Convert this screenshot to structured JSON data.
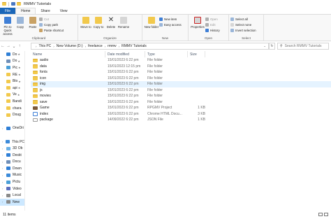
{
  "window": {
    "title": "RMMV Tutorials"
  },
  "tabs": [
    "File",
    "Home",
    "Share",
    "View"
  ],
  "ribbon": {
    "clipboard": {
      "label": "Clipboard",
      "pin": "Pin to Quick access",
      "copy": "Copy",
      "paste": "Paste",
      "cut": "Cut",
      "copy_path": "Copy path",
      "paste_shortcut": "Paste shortcut"
    },
    "organize": {
      "label": "Organize",
      "move_to": "Move to",
      "copy_to": "Copy to",
      "delete": "Delete",
      "rename": "Rename"
    },
    "new": {
      "label": "New",
      "new_folder": "New folder",
      "new_item": "New item",
      "easy_access": "Easy access"
    },
    "open": {
      "label": "Open",
      "properties": "Properties",
      "open": "Open",
      "edit": "Edit",
      "history": "History"
    },
    "select": {
      "label": "Select",
      "select_all": "Select all",
      "select_none": "Select none",
      "invert": "Invert selection"
    }
  },
  "address": {
    "crumbs": [
      "This PC",
      "New Volume (D:)",
      "freelance",
      "rmmv",
      "RMMV Tutorials"
    ],
    "search_placeholder": "Search RMMV Tutorials"
  },
  "nav": [
    {
      "label": "Do",
      "icon": "download-icon",
      "color": "#2f7fd6",
      "pin": true,
      "expand": false
    },
    {
      "label": "Do",
      "icon": "document-icon",
      "color": "#6f8fb8",
      "pin": true,
      "expand": false
    },
    {
      "label": "Pic",
      "icon": "pictures-icon",
      "color": "#4a9fd8",
      "pin": true,
      "expand": false
    },
    {
      "label": "RE",
      "icon": "folder-icon",
      "color": "#f2c94c",
      "pin": true,
      "expand": false
    },
    {
      "label": "Blo",
      "icon": "folder-icon",
      "color": "#f2c94c",
      "pin": true,
      "expand": false
    },
    {
      "label": "api",
      "icon": "folder-icon",
      "color": "#f2c94c",
      "pin": true,
      "expand": false
    },
    {
      "label": "Ve",
      "icon": "folder-icon",
      "color": "#f2c94c",
      "pin": true,
      "expand": false
    },
    {
      "label": "Bandi",
      "icon": "folder-icon",
      "color": "#f2c94c",
      "pin": false,
      "expand": false
    },
    {
      "label": "chara",
      "icon": "folder-icon",
      "color": "#f2c94c",
      "pin": false,
      "expand": false
    },
    {
      "label": "Doug",
      "icon": "folder-icon",
      "color": "#f2c94c",
      "pin": false,
      "expand": false
    },
    {
      "label": "",
      "icon": "",
      "color": "",
      "pin": false,
      "expand": false
    },
    {
      "label": "OneDri",
      "icon": "cloud-icon",
      "color": "#2f7fd6",
      "pin": false,
      "expand": true
    },
    {
      "label": "",
      "icon": "",
      "color": "",
      "pin": false,
      "expand": false
    },
    {
      "label": "This PC",
      "icon": "computer-icon",
      "color": "#3b8ad9",
      "pin": false,
      "expand": true
    },
    {
      "label": "3D Ob",
      "icon": "cube-icon",
      "color": "#6ab0e6",
      "pin": false,
      "expand": true
    },
    {
      "label": "Deskt",
      "icon": "desktop-icon",
      "color": "#2f7fd6",
      "pin": false,
      "expand": true
    },
    {
      "label": "Docu",
      "icon": "document-icon",
      "color": "#6f8fb8",
      "pin": false,
      "expand": true
    },
    {
      "label": "Down",
      "icon": "download-icon",
      "color": "#2f7fd6",
      "pin": false,
      "expand": true
    },
    {
      "label": "Music",
      "icon": "music-icon",
      "color": "#3b8ad9",
      "pin": false,
      "expand": true
    },
    {
      "label": "Pictu",
      "icon": "pictures-icon",
      "color": "#4a9fd8",
      "pin": false,
      "expand": true
    },
    {
      "label": "Video",
      "icon": "video-icon",
      "color": "#5b6fbf",
      "pin": false,
      "expand": true
    },
    {
      "label": "Local",
      "icon": "drive-icon",
      "color": "#8a8a8a",
      "pin": false,
      "expand": true
    },
    {
      "label": "New",
      "icon": "drive-icon",
      "color": "#8a8a8a",
      "pin": false,
      "expand": true,
      "selected": true
    }
  ],
  "columns": [
    "Name",
    "Date modified",
    "Type",
    "Size"
  ],
  "files": [
    {
      "name": "audio",
      "date": "15/01/2023 6:22 pm",
      "type": "File folder",
      "size": "",
      "icon": "folder"
    },
    {
      "name": "data",
      "date": "15/01/2023 12:15 pm",
      "type": "File folder",
      "size": "",
      "icon": "folder"
    },
    {
      "name": "fonts",
      "date": "15/01/2023 6:22 pm",
      "type": "File folder",
      "size": "",
      "icon": "folder"
    },
    {
      "name": "icon",
      "date": "15/01/2023 6:22 pm",
      "type": "File folder",
      "size": "",
      "icon": "folder"
    },
    {
      "name": "img",
      "date": "15/01/2023 6:22 pm",
      "type": "File folder",
      "size": "",
      "icon": "folder",
      "selected": true
    },
    {
      "name": "js",
      "date": "15/01/2023 6:22 pm",
      "type": "File folder",
      "size": "",
      "icon": "folder"
    },
    {
      "name": "movies",
      "date": "15/01/2023 6:22 pm",
      "type": "File folder",
      "size": "",
      "icon": "folder"
    },
    {
      "name": "save",
      "date": "16/01/2023 6:22 pm",
      "type": "File folder",
      "size": "",
      "icon": "folder"
    },
    {
      "name": "Game",
      "date": "15/01/2023 6:22 pm",
      "type": "RPGMV Project",
      "size": "1 KB",
      "icon": "rpg"
    },
    {
      "name": "index",
      "date": "16/01/2023 6:22 pm",
      "type": "Chrome HTML Docu...",
      "size": "3 KB",
      "icon": "html"
    },
    {
      "name": "package",
      "date": "14/09/2022 6:22 pm",
      "type": "JSON File",
      "size": "1 KB",
      "icon": "json"
    }
  ],
  "status": {
    "count": "11 items"
  }
}
